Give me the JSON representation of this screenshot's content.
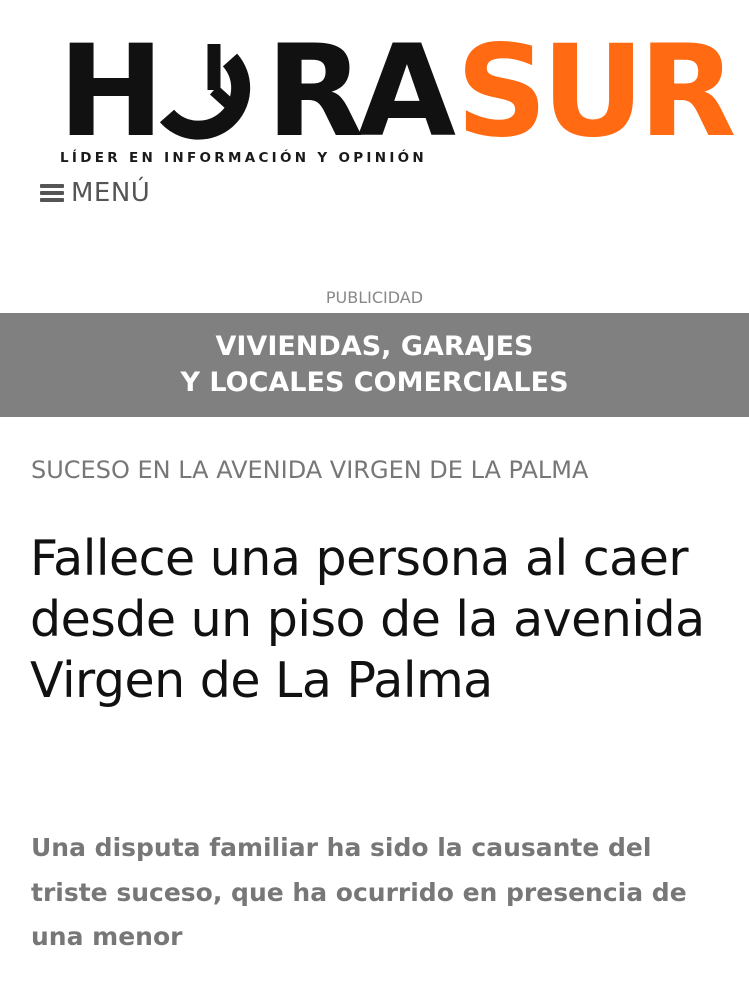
{
  "header": {
    "logo": {
      "letters": [
        "H",
        "RA",
        "SUR"
      ],
      "tagline": "LÍDER EN INFORMACIÓN Y OPINIÓN",
      "colors": {
        "primary": "#111111",
        "accent": "#FF6A13"
      },
      "clock_icon": "clock-icon"
    },
    "menu": {
      "icon": "hamburger-icon",
      "label": "MENÚ"
    }
  },
  "ad": {
    "label": "PUBLICIDAD",
    "line1": "VIVIENDAS, GARAJES",
    "line2": "Y LOCALES COMERCIALES",
    "background": "#808080"
  },
  "article": {
    "kicker": "SUCESO EN LA AVENIDA VIRGEN DE LA PALMA",
    "headline": "Fallece una persona al caer desde un piso de la avenida Virgen de La Palma",
    "subtitle": "Una disputa familiar ha sido la causante del triste suceso, que ha ocurrido en presencia de una menor"
  }
}
